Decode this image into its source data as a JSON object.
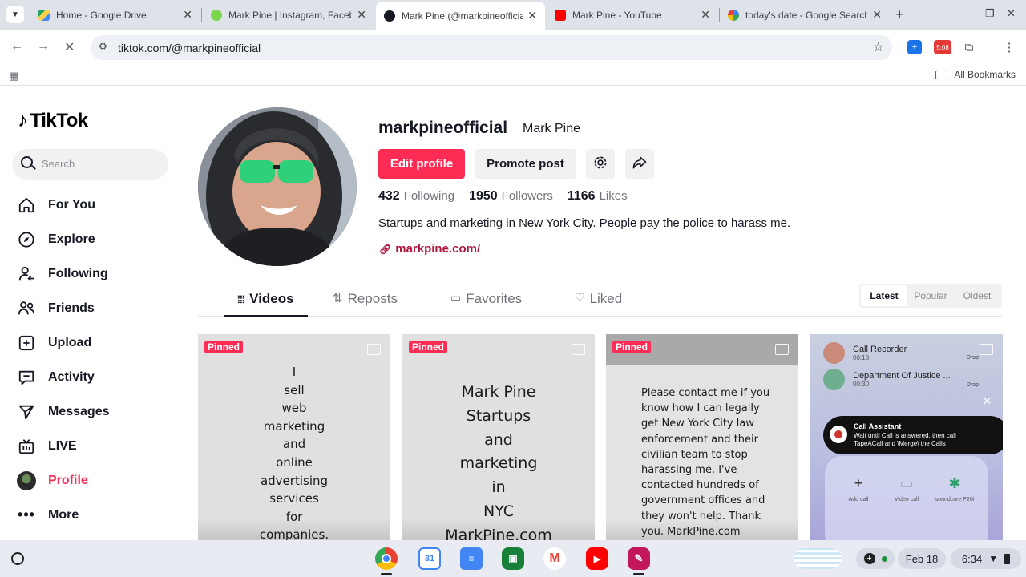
{
  "browser": {
    "tabs": [
      {
        "title": "Home - Google Drive",
        "favicon_color": "#1fa463",
        "active": false
      },
      {
        "title": "Mark Pine | Instagram, Faceb",
        "favicon_color": "#7cd64b",
        "active": false
      },
      {
        "title": "Mark Pine (@markpineofficial",
        "favicon_color": "#161823",
        "active": true
      },
      {
        "title": "Mark Pine - YouTube",
        "favicon_color": "#ff0000",
        "active": false
      },
      {
        "title": "today's date - Google Search",
        "favicon_color": "#4285f4",
        "active": false
      }
    ],
    "url": "tiktok.com/@markpineofficial",
    "all_bookmarks": "All Bookmarks",
    "extension_badge": "5:08"
  },
  "tiktok": {
    "logo_text": "TikTok",
    "search_placeholder": "Search",
    "nav": [
      {
        "label": "For You",
        "icon": "home-icon"
      },
      {
        "label": "Explore",
        "icon": "compass-icon"
      },
      {
        "label": "Following",
        "icon": "following-user-icon"
      },
      {
        "label": "Friends",
        "icon": "friends-icon"
      },
      {
        "label": "Upload",
        "icon": "upload-plus-icon"
      },
      {
        "label": "Activity",
        "icon": "activity-message-icon"
      },
      {
        "label": "Messages",
        "icon": "send-icon"
      },
      {
        "label": "LIVE",
        "icon": "live-tv-icon"
      },
      {
        "label": "Profile",
        "icon": "avatar-icon"
      },
      {
        "label": "More",
        "icon": "more-dots-icon"
      }
    ],
    "active_nav": "Profile",
    "accent": "#fe2c55"
  },
  "profile": {
    "username": "markpineofficial",
    "nickname": "Mark Pine",
    "edit_label": "Edit profile",
    "promote_label": "Promote post",
    "following_count": "432",
    "following_label": "Following",
    "followers_count": "1950",
    "followers_label": "Followers",
    "likes_count": "1166",
    "likes_label": "Likes",
    "bio": "Startups and marketing in New York City. People pay the police to harass me.",
    "link": "markpine.com/"
  },
  "content_tabs": [
    {
      "label": "Videos",
      "active": true
    },
    {
      "label": "Reposts",
      "active": false
    },
    {
      "label": "Favorites",
      "active": false
    },
    {
      "label": "Liked",
      "active": false
    }
  ],
  "sort_options": [
    "Latest",
    "Popular",
    "Oldest"
  ],
  "sort_selected": "Latest",
  "cards": [
    {
      "pinned": "Pinned",
      "text": "I\nsell\nweb\nmarketing\nand\nonline\nadvertising\nservices\nfor\ncompanies."
    },
    {
      "pinned": "Pinned",
      "text": "Mark Pine\nStartups\nand\nmarketing\nin\nNYC\nMarkPine.com"
    },
    {
      "pinned": "Pinned",
      "text": "Please contact me if you\nknow how I can legally\nget New York City law\nenforcement and their\ncivilian team to stop\nharassing me. I've\ncontacted hundreds of\ngovernment offices and\nthey won't help. Thank\nyou. MarkPine.com"
    },
    {
      "call1_name": "Call Recorder",
      "call1_time": "00:18",
      "call2_name": "Department Of Justice ...",
      "call2_time": "00:30",
      "drop_label": "Drop",
      "assistant_title": "Call Assistant",
      "assistant_text": "Wait until Call is answered, then call TapeACall and \\Merge\\ the Calls",
      "add_call": "Add call",
      "video_call": "Video call",
      "audio_device": "soundcore P20i"
    }
  ],
  "shelf": {
    "date": "Feb 18",
    "time": "6:34"
  }
}
